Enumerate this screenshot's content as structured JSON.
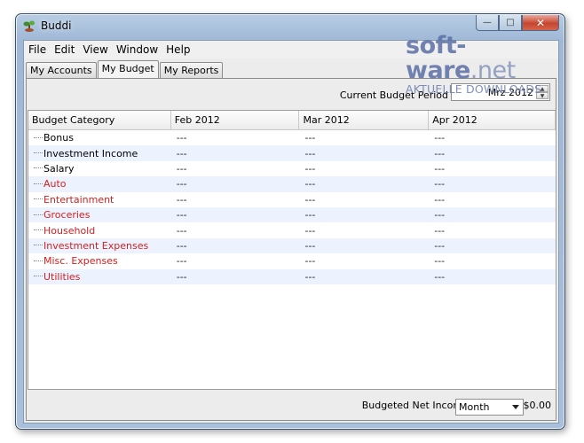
{
  "window": {
    "title": "Buddi"
  },
  "watermark": {
    "text_a": "soft",
    "text_sep": "-",
    "text_b": "ware",
    "text_c": ".net",
    "sub": "AKTUELLE DOWNLOADS"
  },
  "menu": [
    "File",
    "Edit",
    "View",
    "Window",
    "Help"
  ],
  "tabs": [
    {
      "label": "My Accounts",
      "active": false
    },
    {
      "label": "My Budget",
      "active": true
    },
    {
      "label": "My Reports",
      "active": false
    }
  ],
  "period": {
    "label": "Current Budget Period",
    "value": "Mrz 2012"
  },
  "table": {
    "headers": [
      "Budget Category",
      "Feb 2012",
      "Mar 2012",
      "Apr 2012"
    ],
    "rows": [
      {
        "category": "Bonus",
        "type": "income",
        "values": [
          "---",
          "---",
          "---"
        ]
      },
      {
        "category": "Investment Income",
        "type": "income",
        "values": [
          "---",
          "---",
          "---"
        ]
      },
      {
        "category": "Salary",
        "type": "income",
        "values": [
          "---",
          "---",
          "---"
        ]
      },
      {
        "category": "Auto",
        "type": "expense",
        "values": [
          "---",
          "---",
          "---"
        ]
      },
      {
        "category": "Entertainment",
        "type": "expense",
        "values": [
          "---",
          "---",
          "---"
        ]
      },
      {
        "category": "Groceries",
        "type": "expense",
        "values": [
          "---",
          "---",
          "---"
        ]
      },
      {
        "category": "Household",
        "type": "expense",
        "values": [
          "---",
          "---",
          "---"
        ]
      },
      {
        "category": "Investment Expenses",
        "type": "expense",
        "values": [
          "---",
          "---",
          "---"
        ]
      },
      {
        "category": "Misc. Expenses",
        "type": "expense",
        "values": [
          "---",
          "---",
          "---"
        ]
      },
      {
        "category": "Utilities",
        "type": "expense",
        "values": [
          "---",
          "---",
          "---"
        ]
      }
    ]
  },
  "footer": {
    "label": "Budgeted Net Income /",
    "period_select": "Month",
    "amount": "$0.00"
  },
  "colors": {
    "expense": "#d42020",
    "income": "#000000",
    "alt_row": "#edf3fe"
  },
  "icons": {
    "app": "buddi-plant-icon",
    "minimize": "minimize-icon",
    "maximize": "maximize-icon",
    "close": "close-icon"
  }
}
